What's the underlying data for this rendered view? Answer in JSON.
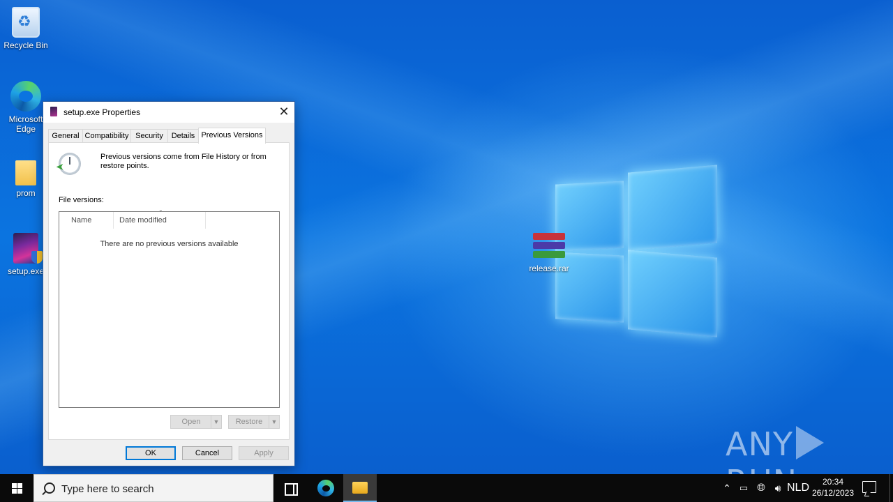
{
  "desktop": {
    "icons": [
      {
        "label": "Recycle Bin"
      },
      {
        "label": "Microsoft Edge"
      },
      {
        "label": "prom"
      },
      {
        "label": "setup.exe"
      },
      {
        "label": "release.rar"
      }
    ],
    "watermark": {
      "left": "ANY",
      "right": "RUN"
    }
  },
  "dialog": {
    "title": "setup.exe Properties",
    "close": "✕",
    "tabs": [
      "General",
      "Compatibility",
      "Security",
      "Details",
      "Previous Versions"
    ],
    "active_tab": "Previous Versions",
    "info_text": "Previous versions come from File History or from restore points.",
    "file_versions_label": "File versions:",
    "columns": [
      "Name",
      "Date modified"
    ],
    "empty_message": "There are no previous versions available",
    "open_button": "Open",
    "restore_button": "Restore",
    "ok_button": "OK",
    "cancel_button": "Cancel",
    "apply_button": "Apply"
  },
  "taskbar": {
    "search_placeholder": "Type here to search",
    "language": "NLD",
    "time": "20:34",
    "date": "26/12/2023",
    "tray_up_arrow": "^",
    "accent": "#76b9ed"
  }
}
